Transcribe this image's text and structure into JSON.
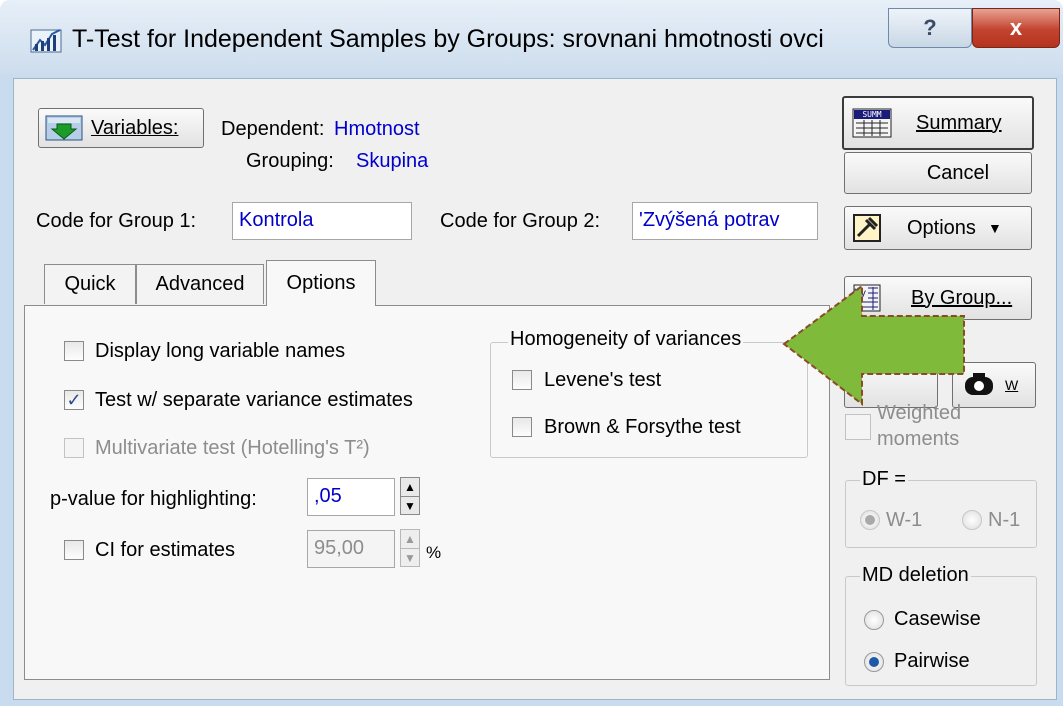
{
  "window": {
    "title": "T-Test for Independent Samples by Groups: srovnani hmotnosti ovci",
    "help_label": "?",
    "close_label": "x"
  },
  "variables": {
    "button_label": "Variables:",
    "dependent_label": "Dependent:",
    "dependent_value": "Hmotnost",
    "grouping_label": "Grouping:",
    "grouping_value": "Skupina"
  },
  "codes": {
    "group1_label": "Code for Group 1:",
    "group1_value": "Kontrola",
    "group2_label": "Code for Group 2:",
    "group2_value": "'Zvýšená potrav"
  },
  "tabs": [
    {
      "label": "Quick"
    },
    {
      "label": "Advanced"
    },
    {
      "label": "Options",
      "active": true
    }
  ],
  "options": {
    "display_long_names": {
      "label": "Display long variable names",
      "checked": false
    },
    "separate_variance": {
      "label": "Test w/ separate variance estimates",
      "checked": true
    },
    "multivariate": {
      "label": "Multivariate test (Hotelling's T²)",
      "checked": false,
      "disabled": true
    },
    "pvalue_label": "p-value for highlighting:",
    "pvalue_value": ",05",
    "ci": {
      "label": "CI for estimates",
      "checked": false
    },
    "ci_value": "95,00",
    "ci_unit": "%"
  },
  "homogeneity": {
    "title": "Homogeneity of variances",
    "levene": {
      "label": "Levene's test",
      "checked": false
    },
    "brown_forsythe": {
      "label": "Brown & Forsythe test",
      "checked": false
    }
  },
  "side": {
    "summary_label": "Summary",
    "summary_icon_text": "SUMM",
    "cancel_label": "Cancel",
    "options_label": "Options",
    "bygroup_label": "By Group...",
    "bygroup_icon_text": "by",
    "w_label": "W",
    "weighted_label_1": "Weighted",
    "weighted_label_2": "moments",
    "df_title": "DF =",
    "df_w1": "W-1",
    "df_n1": "N-1",
    "md_title": "MD deletion",
    "md_casewise": "Casewise",
    "md_pairwise": "Pairwise"
  },
  "colors": {
    "arrow_fill": "#7fba3a",
    "arrow_stroke": "#8b4a2a",
    "value_text": "#0000cc"
  }
}
